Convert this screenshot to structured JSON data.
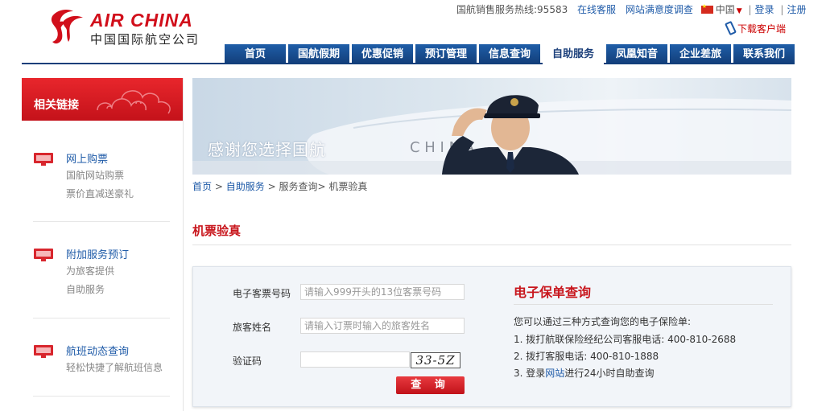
{
  "brand": {
    "name_en": "AIR CHINA",
    "name_cn": "中国国际航空公司",
    "logo": "phoenix-logo-icon",
    "red": "#d10f1b"
  },
  "topbar": {
    "hotline": "国航销售服务热线:95583",
    "online_service": "在线客服",
    "survey": "网站满意度调查",
    "language": "中国",
    "login": "登录",
    "register": "注册",
    "download": "下载客户端"
  },
  "nav": {
    "active": "自助服务",
    "items": [
      "首页",
      "国航假期",
      "优惠促销",
      "预订管理",
      "信息查询",
      "自助服务",
      "凤凰知音",
      "企业差旅",
      "联系我们"
    ]
  },
  "sidebar": {
    "heading": "相关链接",
    "items": [
      {
        "title": "网上购票",
        "lines": [
          "国航网站购票",
          "票价直减送豪礼"
        ]
      },
      {
        "title": "附加服务预订",
        "lines": [
          "为旅客提供",
          "自助服务"
        ]
      },
      {
        "title": "航班动态查询",
        "lines": [
          "轻松快捷了解航班信息"
        ]
      }
    ]
  },
  "banner": {
    "text": "感谢您选择国航"
  },
  "breadcrumb": {
    "home": "首页",
    "sep": ">",
    "self_service": "自助服务",
    "rest": "服务查询> 机票验真"
  },
  "page": {
    "title": "机票验真"
  },
  "form": {
    "ticket_label": "电子客票号码",
    "ticket_placeholder": "请输入999开头的13位客票号码",
    "name_label": "旅客姓名",
    "name_placeholder": "请输入订票时输入的旅客姓名",
    "captcha_label": "验证码",
    "captcha_text": "33-5Z",
    "submit": "查 询"
  },
  "insurance": {
    "title": "电子保单查询",
    "intro": "您可以通过三种方式查询您的电子保险单:",
    "line1": "1. 拨打航联保险经纪公司客服电话: 400-810-2688",
    "line2": "2. 拨打客服电话: 400-810-1888",
    "line3_prefix": "3. 登录",
    "line3_link": "网站",
    "line3_suffix": "进行24小时自助查询"
  }
}
